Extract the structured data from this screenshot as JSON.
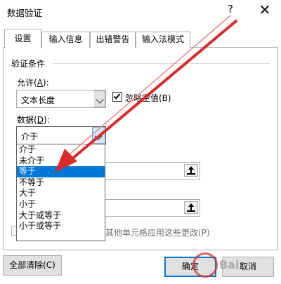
{
  "window": {
    "title": "数据验证",
    "help": "?",
    "close": "✕"
  },
  "tabs": [
    {
      "label": "设置",
      "active": true
    },
    {
      "label": "输入信息",
      "active": false
    },
    {
      "label": "出错警告",
      "active": false
    },
    {
      "label": "输入法模式",
      "active": false
    }
  ],
  "settings": {
    "section_title": "验证条件",
    "allow_label_prefix": "允许(",
    "allow_label_key": "A",
    "allow_label_suffix": "):",
    "allow_value": "文本长度",
    "ignore_blank_label": "忽略空值(B)",
    "ignore_blank_checked": true,
    "data_label_prefix": "数据(",
    "data_label_key": "D",
    "data_label_suffix": "):",
    "data_value": "介于",
    "data_options": [
      "介于",
      "未介于",
      "等于",
      "不等于",
      "大于",
      "小于",
      "大于或等于",
      "小于或等于"
    ],
    "data_selected_index": 2,
    "apply_label": "其他单元格应用这些更改(P)"
  },
  "buttons": {
    "clear_all": "全部清除(C)",
    "ok": "确定",
    "cancel": "取消"
  },
  "watermark": {
    "text": "Bai"
  },
  "colors": {
    "selection": "#0078d7",
    "arrow": "#d92b2b",
    "dropdown_button": "#cde8ff"
  }
}
